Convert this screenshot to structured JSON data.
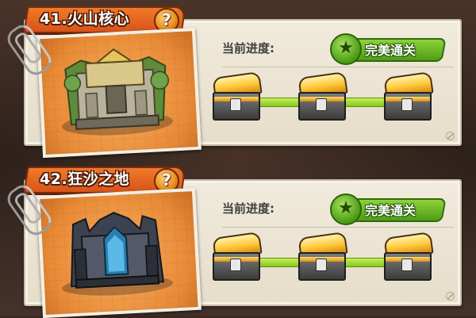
{
  "levels": [
    {
      "title": "41.火山核心",
      "help_icon": "?",
      "progress_label": "当前进度:",
      "badge_text": "完美通关",
      "badge_icon": "★",
      "theme": "jungle-temple",
      "chests": [
        "chest-icon",
        "chest-icon",
        "chest-icon"
      ]
    },
    {
      "title": "42.狂沙之地",
      "help_icon": "?",
      "progress_label": "当前进度:",
      "badge_text": "完美通关",
      "badge_icon": "★",
      "theme": "dark-fortress",
      "chests": [
        "chest-icon",
        "chest-icon",
        "chest-icon"
      ]
    }
  ],
  "colors": {
    "title_tab": "#e0631f",
    "badge_green": "#5aa81c",
    "track_green": "#a6dd2e",
    "chest_gold": "#ffc83a"
  }
}
